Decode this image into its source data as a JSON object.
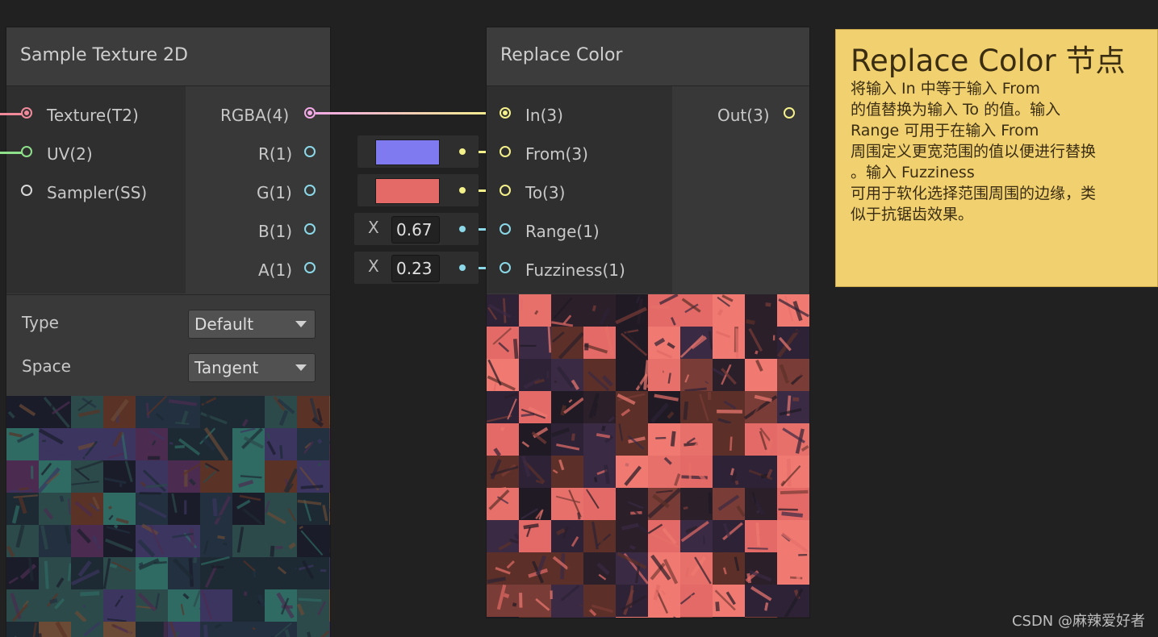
{
  "sample_texture_node": {
    "title": "Sample Texture 2D",
    "inputs": [
      "Texture(T2)",
      "UV(2)",
      "Sampler(SS)"
    ],
    "outputs": [
      "RGBA(4)",
      "R(1)",
      "G(1)",
      "B(1)",
      "A(1)"
    ],
    "properties": {
      "type_label": "Type",
      "type_value": "Default",
      "space_label": "Space",
      "space_value": "Tangent"
    }
  },
  "replace_color_node": {
    "title": "Replace Color",
    "inputs": [
      "In(3)",
      "From(3)",
      "To(3)",
      "Range(1)",
      "Fuzziness(1)"
    ],
    "outputs": [
      "Out(3)"
    ],
    "from_color": "#7f7aef",
    "to_color": "#e36a66",
    "range_axis": "X",
    "range_value": "0.67",
    "fuzziness_axis": "X",
    "fuzziness_value": "0.23"
  },
  "sticky_note": {
    "title": "Replace Color 节点",
    "body": "将输入 In 中等于输入 From\n的值替换为输入 To 的值。输入\nRange 可用于在输入 From\n周围定义更宽范围的值以便进行替换\n。输入 Fuzziness\n可用于软化选择范围周围的边缘，类\n似于抗锯齿效果。"
  },
  "watermark": "CSDN @麻辣爱好者",
  "colors": {
    "texture_port": "#f08a9a",
    "uv_port": "#8ee08a",
    "vector3_port": "#f4f08a",
    "vector4_port": "#f2a9e6",
    "vector1_port": "#8ad8e8",
    "sampler_port": "#d8d8d8"
  }
}
